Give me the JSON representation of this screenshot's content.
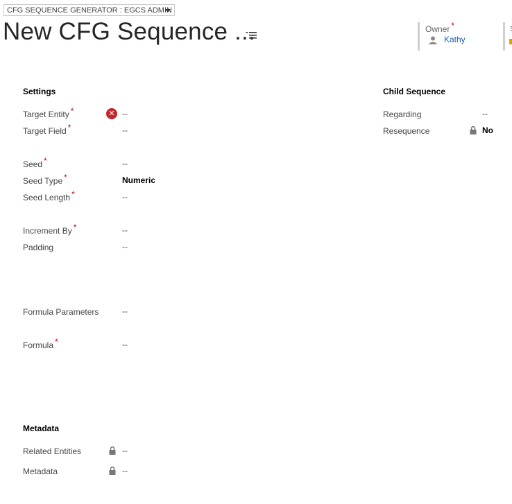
{
  "header": {
    "form_selector": "CFG SEQUENCE GENERATOR : EGCS ADMIN",
    "title": "New CFG Sequence ...",
    "owner_label": "Owner",
    "owner_value": "Kathy",
    "next_field_label_clip": "S"
  },
  "settings": {
    "title": "Settings",
    "fields": {
      "target_entity": {
        "label": "Target Entity",
        "value": "--"
      },
      "target_field": {
        "label": "Target Field",
        "value": "--"
      },
      "seed": {
        "label": "Seed",
        "value": "--"
      },
      "seed_type": {
        "label": "Seed Type",
        "value": "Numeric"
      },
      "seed_length": {
        "label": "Seed Length",
        "value": "--"
      },
      "increment_by": {
        "label": "Increment By",
        "value": "--"
      },
      "padding": {
        "label": "Padding",
        "value": "--"
      },
      "formula_parameters": {
        "label": "Formula Parameters",
        "value": "--"
      },
      "formula": {
        "label": "Formula",
        "value": "--"
      }
    }
  },
  "child_sequence": {
    "title": "Child Sequence",
    "fields": {
      "regarding": {
        "label": "Regarding",
        "value": "--"
      },
      "resequence": {
        "label": "Resequence",
        "value": "No"
      }
    }
  },
  "metadata": {
    "title": "Metadata",
    "fields": {
      "related_entities": {
        "label": "Related Entities",
        "value": "--"
      },
      "metadata": {
        "label": "Metadata",
        "value": "--"
      }
    }
  },
  "required_marker": "*",
  "colors": {
    "required": "#cc0000",
    "link": "#1f5fa8",
    "error": "#c1272d"
  }
}
